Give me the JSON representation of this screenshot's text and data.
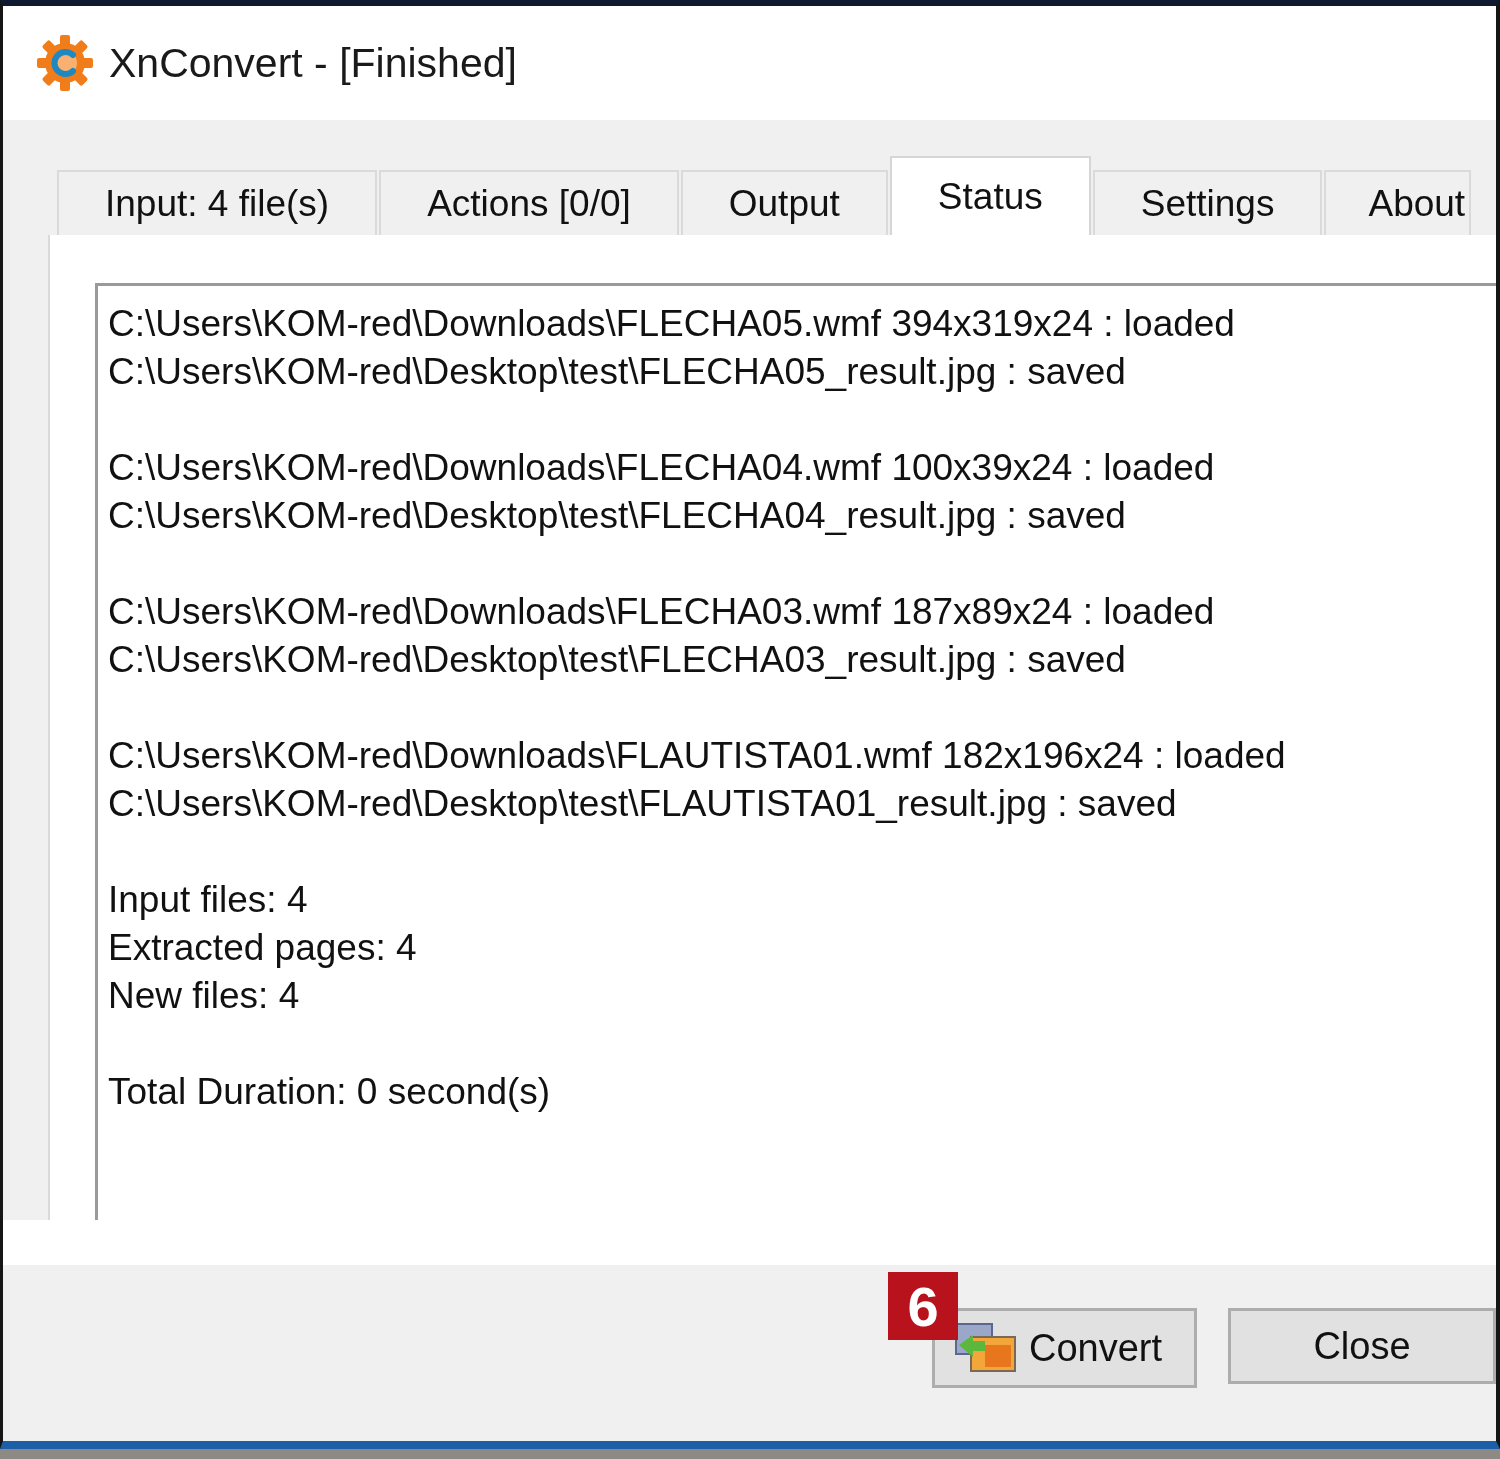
{
  "window": {
    "title": "XnConvert - [Finished]"
  },
  "tabs": [
    {
      "label": "Input: 4 file(s)",
      "selected": false
    },
    {
      "label": "Actions [0/0]",
      "selected": false
    },
    {
      "label": "Output",
      "selected": false
    },
    {
      "label": "Status",
      "selected": true
    },
    {
      "label": "Settings",
      "selected": false
    },
    {
      "label": "About",
      "selected": false
    }
  ],
  "status_log": {
    "file_results": [
      [
        "C:\\Users\\KOM-red\\Downloads\\FLECHA05.wmf 394x319x24 : loaded",
        "C:\\Users\\KOM-red\\Desktop\\test\\FLECHA05_result.jpg : saved"
      ],
      [
        "C:\\Users\\KOM-red\\Downloads\\FLECHA04.wmf 100x39x24 : loaded",
        "C:\\Users\\KOM-red\\Desktop\\test\\FLECHA04_result.jpg : saved"
      ],
      [
        "C:\\Users\\KOM-red\\Downloads\\FLECHA03.wmf 187x89x24 : loaded",
        "C:\\Users\\KOM-red\\Desktop\\test\\FLECHA03_result.jpg : saved"
      ],
      [
        "C:\\Users\\KOM-red\\Downloads\\FLAUTISTA01.wmf 182x196x24 : loaded",
        "C:\\Users\\KOM-red\\Desktop\\test\\FLAUTISTA01_result.jpg : saved"
      ]
    ],
    "summary": [
      "Input files: 4",
      "Extracted pages: 4",
      "New files: 4"
    ],
    "duration": "Total Duration: 0 second(s)"
  },
  "buttons": [
    {
      "label": "Convert",
      "has_icon": true
    },
    {
      "label": "Close",
      "has_icon": false
    }
  ],
  "callout": {
    "label": "6"
  }
}
